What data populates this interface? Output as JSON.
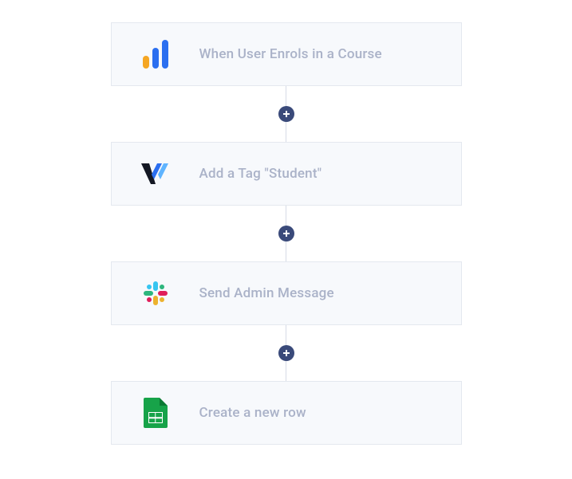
{
  "steps": [
    {
      "label": "When User Enrols in a Course",
      "icon": "bars-icon"
    },
    {
      "label": "Add a Tag \"Student\"",
      "icon": "v-slash-icon"
    },
    {
      "label": "Send Admin Message",
      "icon": "slack-icon"
    },
    {
      "label": "Create a new row",
      "icon": "google-sheets-icon"
    }
  ],
  "colors": {
    "card_bg": "#f7f9fc",
    "card_border": "#e4e8ef",
    "label": "#aab2c8",
    "add_btn": "#3a4a7a"
  }
}
